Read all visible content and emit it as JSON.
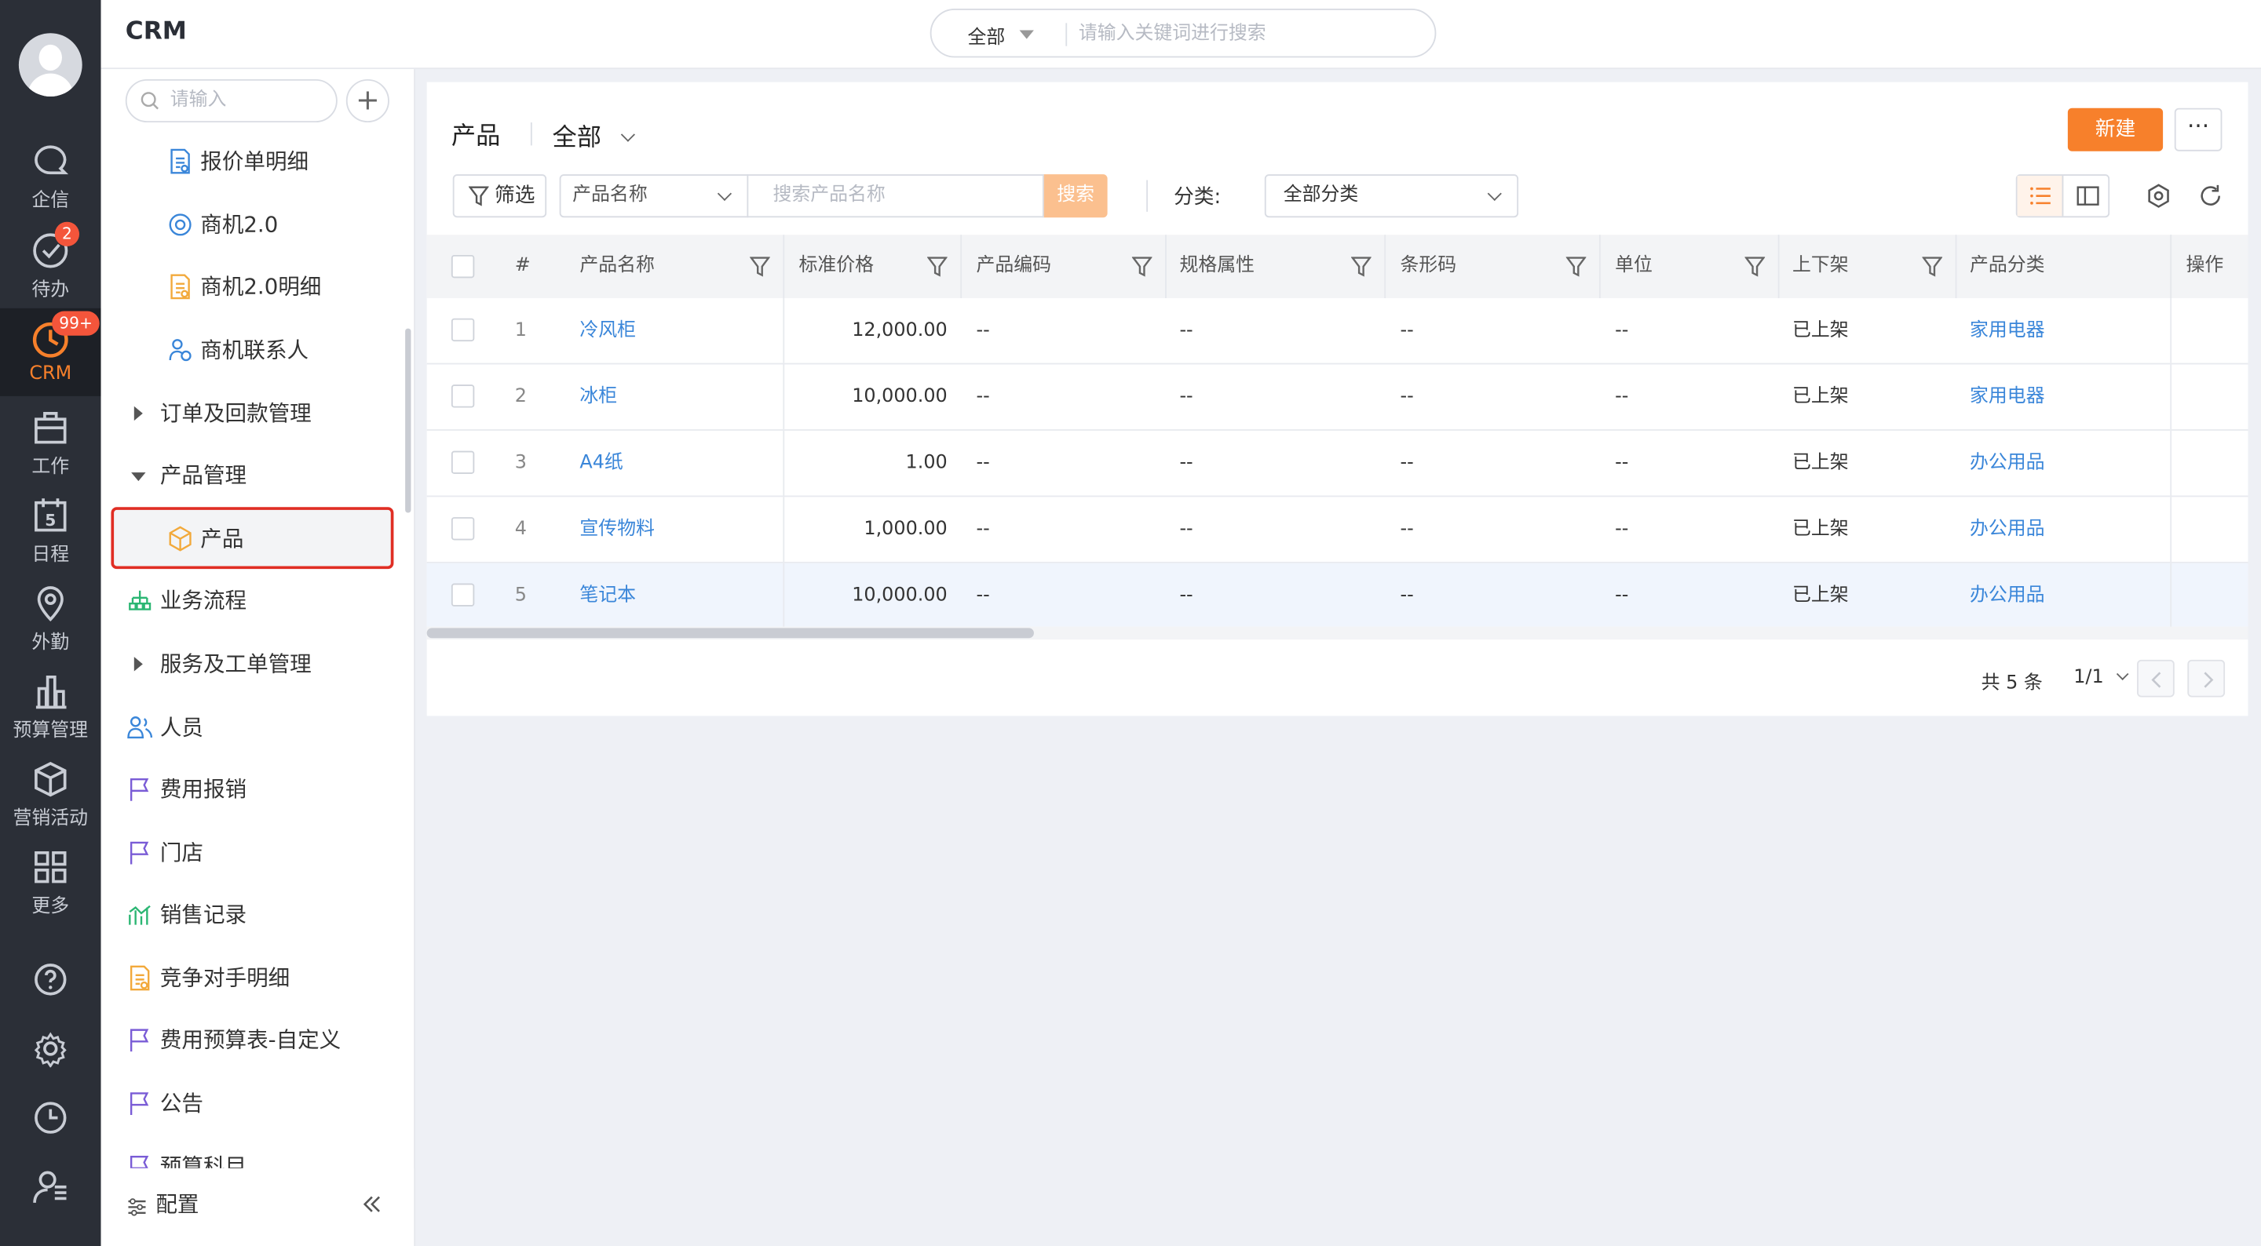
{
  "app": {
    "name": "CRM"
  },
  "global_search": {
    "scope": "全部",
    "placeholder": "请输入关键词进行搜索"
  },
  "rail": {
    "items": [
      {
        "label": "企信",
        "icon": "chat-icon"
      },
      {
        "label": "待办",
        "icon": "check-circle-icon",
        "badge": "2"
      },
      {
        "label": "CRM",
        "icon": "crm-clock-icon",
        "badge": "99+",
        "active": true
      },
      {
        "label": "工作",
        "icon": "briefcase-icon"
      },
      {
        "label": "日程",
        "icon": "calendar-icon",
        "day": "5"
      },
      {
        "label": "外勤",
        "icon": "location-pin-icon"
      },
      {
        "label": "预算管理",
        "icon": "bar-chart-icon"
      },
      {
        "label": "营销活动",
        "icon": "cube-icon"
      },
      {
        "label": "更多",
        "icon": "grid-icon"
      }
    ],
    "bottom_icons": [
      "help-icon",
      "settings-icon",
      "history-icon",
      "user-settings-icon"
    ]
  },
  "sidebar": {
    "search_placeholder": "请输入",
    "items": [
      {
        "label": "报价单明细",
        "icon": "quote-detail-icon"
      },
      {
        "label": "商机2.0",
        "icon": "target-icon"
      },
      {
        "label": "商机2.0明细",
        "icon": "opportunity-detail-icon"
      },
      {
        "label": "商机联系人",
        "icon": "contact-icon"
      },
      {
        "label": "订单及回款管理",
        "icon": "expand-triangle-icon"
      },
      {
        "label": "产品管理",
        "icon": "collapse-triangle-icon"
      },
      {
        "label": "产品",
        "icon": "product-box-icon",
        "selected": true
      },
      {
        "label": "业务流程",
        "icon": "flow-icon"
      },
      {
        "label": "服务及工单管理",
        "icon": "expand-triangle-icon"
      },
      {
        "label": "人员",
        "icon": "people-icon"
      },
      {
        "label": "费用报销",
        "icon": "flag-icon"
      },
      {
        "label": "门店",
        "icon": "flag-icon"
      },
      {
        "label": "销售记录",
        "icon": "sales-chart-icon"
      },
      {
        "label": "竞争对手明细",
        "icon": "competitor-icon"
      },
      {
        "label": "费用预算表-自定义",
        "icon": "flag-icon"
      },
      {
        "label": "公告",
        "icon": "flag-icon"
      },
      {
        "label": "预算科目",
        "icon": "flag-icon"
      }
    ],
    "footer": {
      "config_label": "配置"
    }
  },
  "main": {
    "title": "产品",
    "view": "全部",
    "new_button": "新建",
    "more_button": "···",
    "filter_button": "筛选",
    "field_select": "产品名称",
    "search_placeholder": "搜索产品名称",
    "search_button": "搜索",
    "category_label": "分类:",
    "category_select": "全部分类"
  },
  "table": {
    "columns": [
      "#",
      "产品名称",
      "标准价格",
      "产品编码",
      "规格属性",
      "条形码",
      "单位",
      "上下架",
      "产品分类",
      "操作"
    ],
    "rows": [
      {
        "no": "1",
        "name": "冷风柜",
        "price": "12,000.00",
        "code": "--",
        "spec": "--",
        "barcode": "--",
        "unit": "--",
        "status": "已上架",
        "category": "家用电器"
      },
      {
        "no": "2",
        "name": "冰柜",
        "price": "10,000.00",
        "code": "--",
        "spec": "--",
        "barcode": "--",
        "unit": "--",
        "status": "已上架",
        "category": "家用电器"
      },
      {
        "no": "3",
        "name": "A4纸",
        "price": "1.00",
        "code": "--",
        "spec": "--",
        "barcode": "--",
        "unit": "--",
        "status": "已上架",
        "category": "办公用品"
      },
      {
        "no": "4",
        "name": "宣传物料",
        "price": "1,000.00",
        "code": "--",
        "spec": "--",
        "barcode": "--",
        "unit": "--",
        "status": "已上架",
        "category": "办公用品"
      },
      {
        "no": "5",
        "name": "笔记本",
        "price": "10,000.00",
        "code": "--",
        "spec": "--",
        "barcode": "--",
        "unit": "--",
        "status": "已上架",
        "category": "办公用品"
      }
    ]
  },
  "pagination": {
    "total": "共 5 条",
    "page": "1/1"
  },
  "colors": {
    "accent": "#f7802b",
    "link": "#3a86d9",
    "rail_bg": "#2b2f37",
    "selected_outline": "#e02e24",
    "badge": "#f4553b"
  }
}
